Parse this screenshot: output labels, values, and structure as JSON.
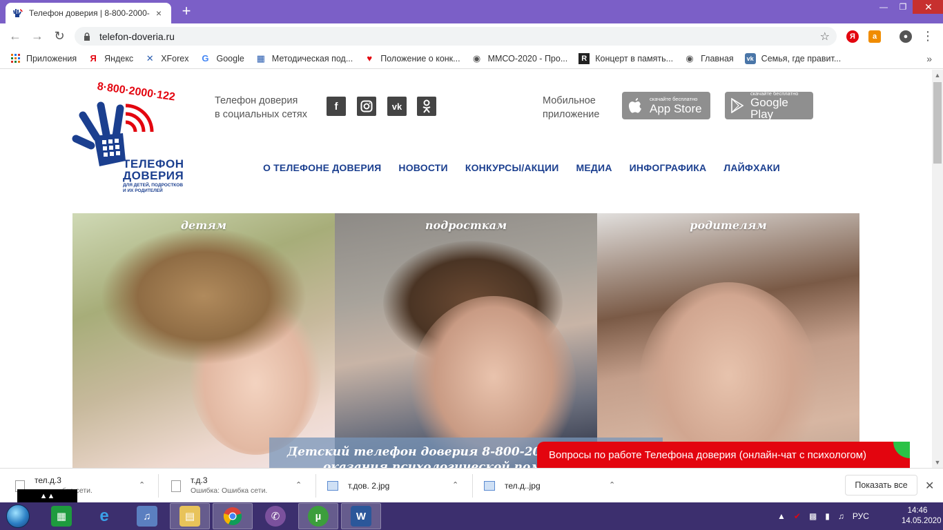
{
  "browser": {
    "tab_title": "Телефон доверия | 8-800-2000-",
    "tab_close": "×",
    "new_tab": "+",
    "url": "telefon-doveria.ru"
  },
  "bookmarks": [
    {
      "label": "Приложения",
      "icon": "apps-grid-icon"
    },
    {
      "label": "Яндекс",
      "icon": "yandex-icon"
    },
    {
      "label": "XForex",
      "icon": "xforex-icon"
    },
    {
      "label": "Google",
      "icon": "google-icon"
    },
    {
      "label": "Методическая под...",
      "icon": "building-icon"
    },
    {
      "label": "Положение о конк...",
      "icon": "heart-icon"
    },
    {
      "label": "ММСО-2020 - Про...",
      "icon": "globe-icon"
    },
    {
      "label": "Концерт в память...",
      "icon": "r-icon"
    },
    {
      "label": "Главная",
      "icon": "globe-icon"
    },
    {
      "label": "Семья, где правит...",
      "icon": "vk-icon"
    }
  ],
  "site": {
    "logo": {
      "phone": "8·800·2000·122",
      "title_line1": "ТЕЛЕФОН",
      "title_line2": "ДОВЕРИЯ",
      "subtitle_line1": "ДЛЯ ДЕТЕЙ, ПОДРОСТКОВ",
      "subtitle_line2": "И ИХ РОДИТЕЛЕЙ"
    },
    "social_label_line1": "Телефон доверия",
    "social_label_line2": "в социальных сетях",
    "social_icons": [
      "facebook-icon",
      "instagram-icon",
      "vk-icon",
      "odnoklassniki-icon"
    ],
    "mobile_label_line1": "Мобильное",
    "mobile_label_line2": "приложение",
    "appstore_small": "скачайте бесплатно",
    "appstore_big": "App Store",
    "googleplay_small": "скачайте бесплатно",
    "googleplay_big": "Google Play",
    "nav": [
      "О ТЕЛЕФОНЕ ДОВЕРИЯ",
      "НОВОСТИ",
      "КОНКУРСЫ/АКЦИИ",
      "МЕДИА",
      "ИНФОГРАФИКА",
      "ЛАЙФХАКИ"
    ],
    "panels": [
      "детям",
      "подросткам",
      "родителям"
    ],
    "banner_line1": "Детский телефон доверия 8-800-2000",
    "banner_line2": "оказания психологической помо",
    "chat_label": "Вопросы по работе Телефона доверия (онлайн-чат с психологом)"
  },
  "downloads": [
    {
      "name": "тел.д.3",
      "status": "бка сети."
    },
    {
      "name": "т.д.3",
      "status": "Ошибка: Ошибка сети."
    },
    {
      "name": "т.дов. 2.jpg",
      "status": ""
    },
    {
      "name": "тел.д..jpg",
      "status": ""
    }
  ],
  "show_all": "Показать все",
  "taskbar": {
    "lang": "РУС",
    "time": "14:46",
    "date": "14.05.2020"
  },
  "colors": {
    "tabstrip": "#7b5fc7",
    "brand_blue": "#1b3f8f",
    "brand_red": "#e3050f",
    "taskbar": "#3c2f6e"
  }
}
